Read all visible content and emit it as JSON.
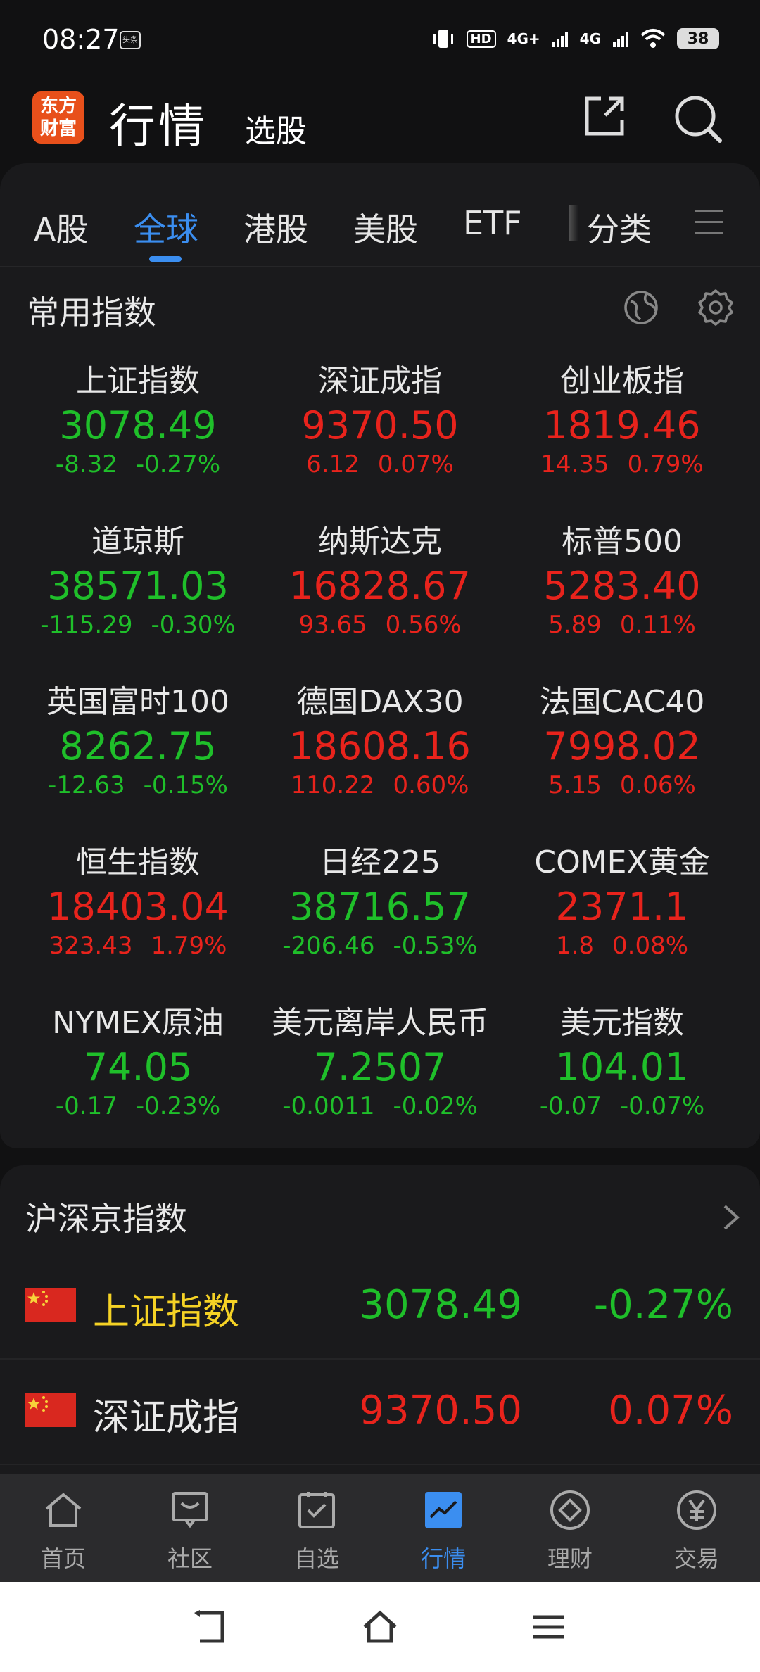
{
  "status": {
    "time": "08:27",
    "app_badge": "头条",
    "icons": [
      "vibrate-icon",
      "hd-icon",
      "signal-4g-plus-icon",
      "signal-4g-icon",
      "wifi-icon"
    ],
    "hd_label": "HD",
    "net1": "4G+",
    "net2": "4G",
    "battery": "38"
  },
  "header": {
    "logo_line1": "东方",
    "logo_line2": "财富",
    "title": "行情",
    "subtitle": "选股"
  },
  "tabs": [
    {
      "label": "A股",
      "active": false
    },
    {
      "label": "全球",
      "active": true
    },
    {
      "label": "港股",
      "active": false
    },
    {
      "label": "美股",
      "active": false
    },
    {
      "label": "ETF",
      "active": false
    },
    {
      "label": "分类",
      "active": false
    }
  ],
  "common_indices": {
    "title": "常用指数",
    "items": [
      {
        "name": "上证指数",
        "price": "3078.49",
        "change": "-8.32",
        "pct": "-0.27%",
        "dir": "down"
      },
      {
        "name": "深证成指",
        "price": "9370.50",
        "change": "6.12",
        "pct": "0.07%",
        "dir": "up"
      },
      {
        "name": "创业板指",
        "price": "1819.46",
        "change": "14.35",
        "pct": "0.79%",
        "dir": "up"
      },
      {
        "name": "道琼斯",
        "price": "38571.03",
        "change": "-115.29",
        "pct": "-0.30%",
        "dir": "down"
      },
      {
        "name": "纳斯达克",
        "price": "16828.67",
        "change": "93.65",
        "pct": "0.56%",
        "dir": "up"
      },
      {
        "name": "标普500",
        "price": "5283.40",
        "change": "5.89",
        "pct": "0.11%",
        "dir": "up"
      },
      {
        "name": "英国富时100",
        "price": "8262.75",
        "change": "-12.63",
        "pct": "-0.15%",
        "dir": "down"
      },
      {
        "name": "德国DAX30",
        "price": "18608.16",
        "change": "110.22",
        "pct": "0.60%",
        "dir": "up"
      },
      {
        "name": "法国CAC40",
        "price": "7998.02",
        "change": "5.15",
        "pct": "0.06%",
        "dir": "up"
      },
      {
        "name": "恒生指数",
        "price": "18403.04",
        "change": "323.43",
        "pct": "1.79%",
        "dir": "up"
      },
      {
        "name": "日经225",
        "price": "38716.57",
        "change": "-206.46",
        "pct": "-0.53%",
        "dir": "down"
      },
      {
        "name": "COMEX黄金",
        "price": "2371.1",
        "change": "1.8",
        "pct": "0.08%",
        "dir": "up"
      },
      {
        "name": "NYMEX原油",
        "price": "74.05",
        "change": "-0.17",
        "pct": "-0.23%",
        "dir": "down"
      },
      {
        "name": "美元离岸人民币",
        "price": "7.2507",
        "change": "-0.0011",
        "pct": "-0.02%",
        "dir": "down"
      },
      {
        "name": "美元指数",
        "price": "104.01",
        "change": "-0.07",
        "pct": "-0.07%",
        "dir": "down"
      }
    ]
  },
  "hsj": {
    "title": "沪深京指数",
    "rows": [
      {
        "name": "上证指数",
        "price": "3078.49",
        "pct": "-0.27%",
        "dir": "down",
        "highlight": true
      },
      {
        "name": "深证成指",
        "price": "9370.50",
        "pct": "0.07%",
        "dir": "up",
        "highlight": false
      }
    ]
  },
  "bottom_nav": [
    {
      "label": "首页",
      "icon": "home-icon",
      "active": false
    },
    {
      "label": "社区",
      "icon": "chat-icon",
      "active": false
    },
    {
      "label": "自选",
      "icon": "watchlist-icon",
      "active": false
    },
    {
      "label": "行情",
      "icon": "market-chart-icon",
      "active": true
    },
    {
      "label": "理财",
      "icon": "diamond-icon",
      "active": false
    },
    {
      "label": "交易",
      "icon": "yen-icon",
      "active": false
    }
  ],
  "colors": {
    "up": "#e8231c",
    "down": "#1fbf2a",
    "accent": "#3b8ef0",
    "highlight": "#f5d225",
    "logo": "#e8501b"
  }
}
